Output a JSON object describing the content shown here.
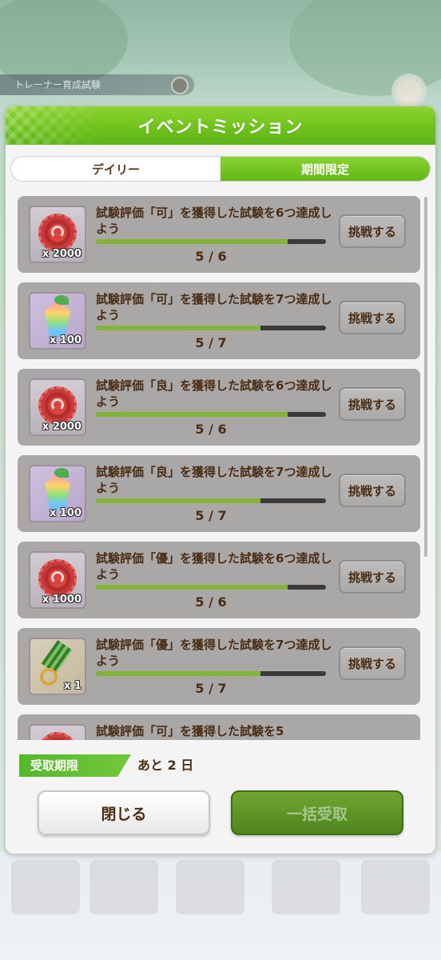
{
  "background": {
    "trainer_bar_text": "トレーナー育成試験"
  },
  "modal": {
    "title": "イベントミッション",
    "tabs": [
      {
        "label": "デイリー",
        "active": false
      },
      {
        "label": "期間限定",
        "active": true
      }
    ],
    "missions": [
      {
        "icon": "red-coin-icon",
        "quantity": "x 2000",
        "text": "試験評価「可」を獲得した試験を6つ達成しよう",
        "progress": "5 / 6",
        "fraction": 0.833,
        "button": "挑戦する"
      },
      {
        "icon": "rainbow-gem-icon",
        "quantity": "x 100",
        "text": "試験評価「可」を獲得した試験を7つ達成しよう",
        "progress": "5 / 7",
        "fraction": 0.714,
        "button": "挑戦する"
      },
      {
        "icon": "red-coin-icon",
        "quantity": "x 2000",
        "text": "試験評価「良」を獲得した試験を6つ達成しよう",
        "progress": "5 / 6",
        "fraction": 0.833,
        "button": "挑戦する"
      },
      {
        "icon": "rainbow-gem-icon",
        "quantity": "x 100",
        "text": "試験評価「良」を獲得した試験を7つ達成しよう",
        "progress": "5 / 7",
        "fraction": 0.714,
        "button": "挑戦する"
      },
      {
        "icon": "red-coin-icon",
        "quantity": "x 1000",
        "text": "試験評価「優」を獲得した試験を6つ達成しよう",
        "progress": "5 / 6",
        "fraction": 0.833,
        "button": "挑戦する"
      },
      {
        "icon": "horseshoe-medal-icon",
        "quantity": "x 1",
        "text": "試験評価「優」を獲得した試験を7つ達成しよう",
        "progress": "5 / 7",
        "fraction": 0.714,
        "button": "挑戦する"
      },
      {
        "icon": "red-coin-icon",
        "quantity": "",
        "text": "試験評価「可」を獲得した試験を5",
        "progress": "",
        "fraction": 0,
        "button": ""
      }
    ],
    "deadline_label": "受取期限",
    "deadline_value": "あと 2 日",
    "close_label": "閉じる",
    "claim_all_label": "一括受取"
  }
}
